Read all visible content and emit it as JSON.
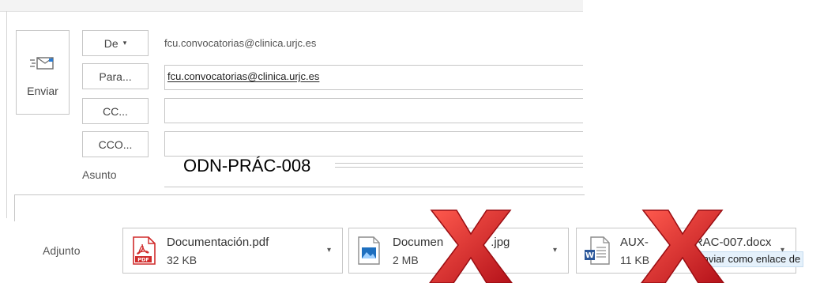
{
  "send": {
    "label": "Enviar",
    "icon": "send-envelope-icon"
  },
  "from": {
    "button_label": "De",
    "value": "fcu.convocatorias@clinica.urjc.es"
  },
  "to": {
    "button_label": "Para...",
    "value": "fcu.convocatorias@clinica.urjc.es"
  },
  "cc": {
    "button_label": "CC...",
    "value": ""
  },
  "bcc": {
    "button_label": "CCO...",
    "value": ""
  },
  "subject": {
    "label": "Asunto",
    "value": "ODN-PRÁC-008"
  },
  "attachments": {
    "label": "Adjunto",
    "items": [
      {
        "name": "Documentación.pdf",
        "size": "32 KB",
        "icon": "pdf-file-icon"
      },
      {
        "name": "Documen",
        "name_tail": ".jpg",
        "size": "2 MB",
        "icon": "image-file-icon"
      },
      {
        "name": "AUX-",
        "name_tail": "RAC-007.docx",
        "size": "11 KB",
        "icon": "word-file-icon"
      }
    ],
    "tooltip": "Enviar como enlace de"
  },
  "overlay_colors": {
    "red_x": "#e0282a"
  }
}
